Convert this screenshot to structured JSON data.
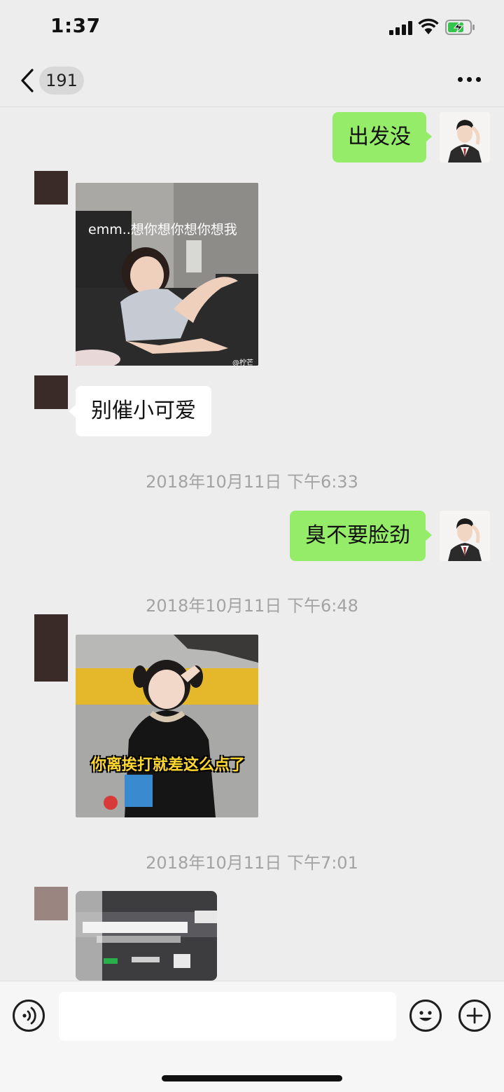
{
  "status_bar": {
    "time": "1:37"
  },
  "nav": {
    "unread_count": "191"
  },
  "messages": [
    {
      "side": "right",
      "type": "text",
      "text": "出发没"
    },
    {
      "side": "left",
      "type": "image",
      "caption": "emm..想你想你想你想我",
      "watermark": "@柠芒"
    },
    {
      "side": "left",
      "type": "text",
      "text": "别催小可爱"
    },
    {
      "type": "timestamp",
      "text": "2018年10月11日 下午6:33"
    },
    {
      "side": "right",
      "type": "text",
      "text": "臭不要脸劲"
    },
    {
      "type": "timestamp",
      "text": "2018年10月11日 下午6:48"
    },
    {
      "side": "left",
      "type": "image",
      "caption": "你离挨打就差这么点了"
    },
    {
      "type": "timestamp",
      "text": "2018年10月11日 下午7:01"
    },
    {
      "side": "left",
      "type": "image",
      "caption": ""
    }
  ],
  "input_bar": {
    "placeholder": ""
  },
  "colors": {
    "self_bubble": "#95ec69",
    "other_bubble": "#ffffff",
    "background": "#ededed"
  }
}
